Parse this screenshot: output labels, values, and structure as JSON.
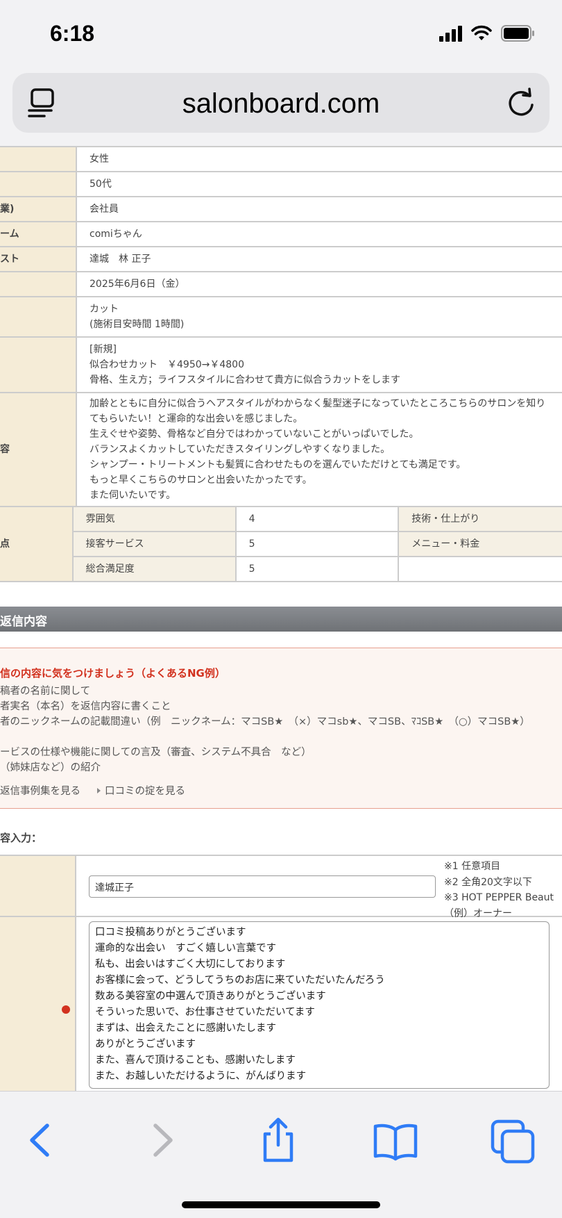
{
  "status": {
    "time": "6:18"
  },
  "browser": {
    "url": "salonboard.com"
  },
  "info_rows": [
    {
      "label": "",
      "lines": [
        "女性"
      ]
    },
    {
      "label": "",
      "lines": [
        "50代"
      ]
    },
    {
      "label": "業)",
      "lines": [
        "会社員"
      ]
    },
    {
      "label": "ーム",
      "lines": [
        "comiちゃん"
      ]
    },
    {
      "label": "スト",
      "lines": [
        "達城　林 正子"
      ]
    },
    {
      "label": "",
      "lines": [
        "2025年6月6日（金）"
      ]
    },
    {
      "label": "",
      "lines": [
        "カット",
        "(施術目安時間 1時間)"
      ]
    },
    {
      "label": "",
      "lines": [
        "[新規]",
        "似合わせカット　￥4950→￥4800",
        "骨格、生え方；ライフスタイルに合わせて貴方に似合うカットをします"
      ]
    },
    {
      "label": "容",
      "lines": [
        "加齢とともに自分に似合うヘアスタイルがわからなく髪型迷子になっていたところこちらのサロンを知り",
        "てもらいたい！と運命的な出会いを感じました。",
        "生えぐせや姿勢、骨格など自分ではわかっていないことがいっぱいでした。",
        "バランスよくカットしていただきスタイリングしやすくなりました。",
        "シャンプー・トリートメントも髪質に合わせたものを選んでいただけとても満足です。",
        "もっと早くこちらのサロンと出会いたかったです。",
        "また伺いたいです。"
      ]
    }
  ],
  "scores": {
    "label": "点",
    "rows": [
      {
        "a_label": "雰囲気",
        "a_value": "4",
        "b_label": "技術・仕上がり"
      },
      {
        "a_label": "接客サービス",
        "a_value": "5",
        "b_label": "メニュー・料金"
      },
      {
        "a_label": "総合満足度",
        "a_value": "5",
        "b_label": ""
      }
    ]
  },
  "reply_section": {
    "title": "返信内容"
  },
  "ng_box": {
    "title": "信の内容に気をつけましょう（よくあるNG例）",
    "lines": [
      "稿者の名前に関して",
      "者実名（本名）を返信内容に書くこと",
      "者のニックネームの記載間違い（例　ニックネーム：マコSB★　（×）マコsb★、マコSB、ﾏｺSB★　（○）マコSB★）",
      "",
      "ービスの仕様や機能に関しての言及（審査、システム不具合　など）",
      "（姉妹店など）の紹介"
    ],
    "link1": "返信事例集を見る",
    "link2": "口コミの掟を見る"
  },
  "input_head": "容入力：",
  "form": {
    "name_value": "達城正子",
    "notes": [
      "※1 任意項目",
      "※2 全角20文字以下",
      "※3 HOT PEPPER Beaut",
      "（例）オーナー"
    ],
    "reply_lines": [
      "口コミ投稿ありがとうございます",
      "運命的な出会い　すごく嬉しい言葉です",
      "私も、出会いはすごく大切にしております",
      "お客様に会って、どうしてうちのお店に来ていただいたんだろう",
      "数ある美容室の中選んで頂きありがとうございます",
      "そういった思いで、お仕事させていただいてます",
      "まずは、出会えたことに感謝いたします",
      "ありがとうございます",
      "また、喜んで頂けることも、感謝いたします",
      "また、お越しいただけるように、がんばります"
    ]
  },
  "icons": {
    "reader": "reader-icon",
    "reload": "reload-icon",
    "back": "chevron-left-icon",
    "forward": "chevron-right-icon",
    "share": "share-icon",
    "bookmarks": "book-icon",
    "tabs": "tabs-icon"
  },
  "colors": {
    "accent_blue": "#2f7cf6",
    "label_bg": "#f5ecd7",
    "ng_red": "#d2321f"
  }
}
